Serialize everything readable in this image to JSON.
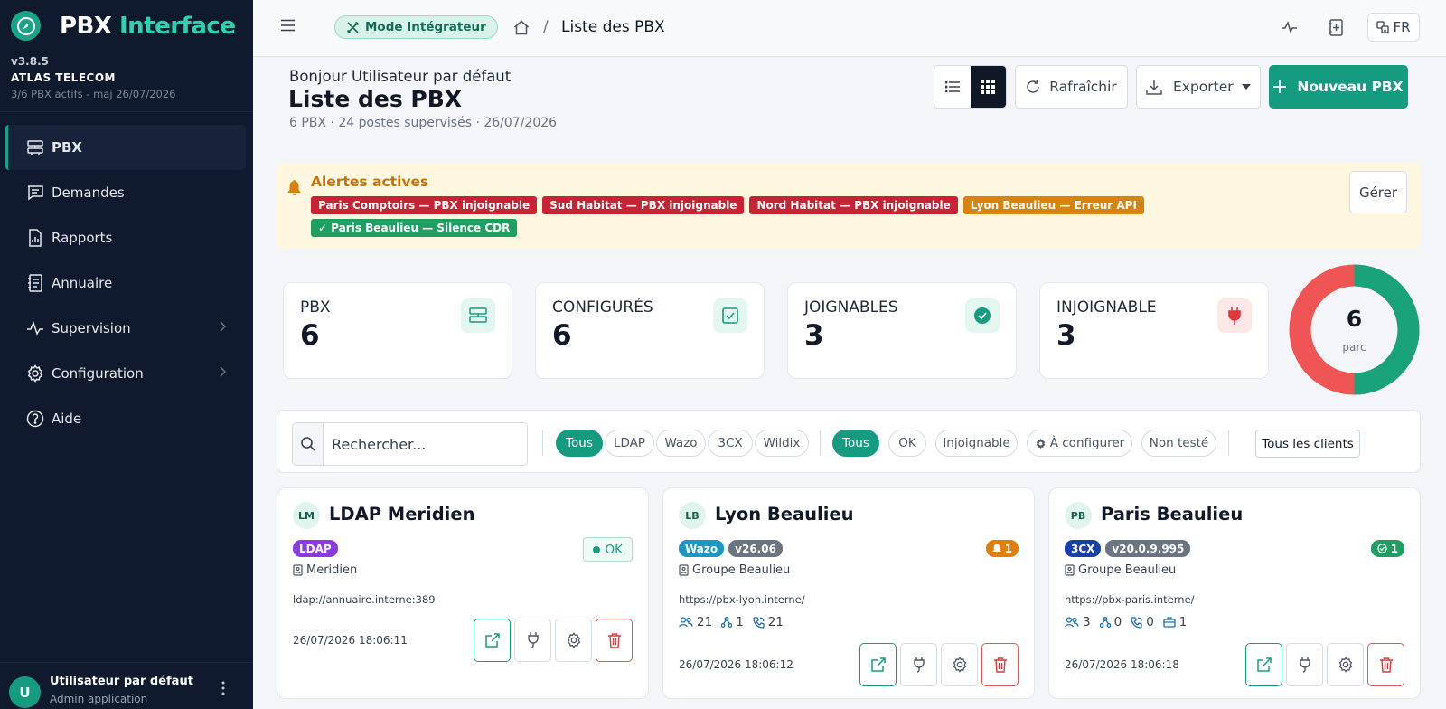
{
  "brand": {
    "name_part1": "PBX",
    "name_part2": "Interface",
    "version": "v3.8.5",
    "company": "ATLAS TELECOM",
    "status": "3/6 PBX actifs - maj 26/07/2026"
  },
  "nav": [
    {
      "label": "PBX",
      "icon": "pbx-icon",
      "active": true
    },
    {
      "label": "Demandes",
      "icon": "chat-icon"
    },
    {
      "label": "Rapports",
      "icon": "report-icon"
    },
    {
      "label": "Annuaire",
      "icon": "book-icon"
    },
    {
      "label": "Supervision",
      "icon": "pulse-icon",
      "has_children": true
    },
    {
      "label": "Configuration",
      "icon": "gear-icon",
      "has_children": true
    },
    {
      "label": "Aide",
      "icon": "help-icon"
    }
  ],
  "user": {
    "initial": "U",
    "name": "Utilisateur par défaut",
    "role": "Admin application"
  },
  "topbar": {
    "mode": "Mode Intégrateur",
    "breadcrumb_sep": "/",
    "breadcrumb_current": "Liste des PBX",
    "lang": "FR"
  },
  "header": {
    "greeting": "Bonjour Utilisateur par défaut",
    "title": "Liste des PBX",
    "subtitle": "6 PBX · 24 postes supervisés · 26/07/2026",
    "refresh": "Rafraîchir",
    "export": "Exporter",
    "new": "Nouveau PBX"
  },
  "alerts": {
    "title": "Alertes actives",
    "manage": "Gérer",
    "items": [
      {
        "text": "Paris Comptoirs — PBX injoignable",
        "level": "red"
      },
      {
        "text": "Sud Habitat — PBX injoignable",
        "level": "red"
      },
      {
        "text": "Nord Habitat — PBX injoignable",
        "level": "red"
      },
      {
        "text": "Lyon Beaulieu — Erreur API",
        "level": "orange"
      },
      {
        "text": "✓ Paris Beaulieu — Silence CDR",
        "level": "green"
      }
    ]
  },
  "stats": [
    {
      "label": "PBX",
      "value": "6",
      "icon": "pbx-icon"
    },
    {
      "label": "CONFIGURÉS",
      "value": "6",
      "icon": "checkbox-icon"
    },
    {
      "label": "JOIGNABLES",
      "value": "3",
      "icon": "check-circle-icon"
    },
    {
      "label": "INJOIGNABLE",
      "value": "3",
      "icon": "plug-icon"
    }
  ],
  "donut": {
    "total": "6",
    "label": "parc",
    "reachable": 3,
    "unreachable": 3,
    "colors": {
      "reachable": "#1aa37a",
      "unreachable": "#ef5555"
    }
  },
  "filters": {
    "search_placeholder": "Rechercher...",
    "types": [
      "Tous",
      "LDAP",
      "Wazo",
      "3CX",
      "Wildix"
    ],
    "states": [
      "Tous",
      "OK",
      "Injoignable",
      "À configurer",
      "Non testé"
    ],
    "clients": "Tous les clients"
  },
  "cards": [
    {
      "initials": "LM",
      "name": "LDAP Meridien",
      "type": "LDAP",
      "version": "",
      "status": "OK",
      "owner": "Meridien",
      "url": "ldap://annuaire.interne:389",
      "timestamp": "26/07/2026 18:06:11"
    },
    {
      "initials": "LB",
      "name": "Lyon Beaulieu",
      "type": "Wazo",
      "version": "v26.06",
      "status": "1",
      "owner": "Groupe Beaulieu",
      "url": "https://pbx-lyon.interne/",
      "metrics": [
        "21",
        "1",
        "21"
      ],
      "timestamp": "26/07/2026 18:06:12"
    },
    {
      "initials": "PB",
      "name": "Paris Beaulieu",
      "type": "3CX",
      "version": "v20.0.9.995",
      "status": "1",
      "owner": "Groupe Beaulieu",
      "url": "https://pbx-paris.interne/",
      "metrics": [
        "3",
        "0",
        "0",
        "1"
      ],
      "timestamp": "26/07/2026 18:06:18"
    }
  ],
  "colors": {
    "accent": "#159b80",
    "sidebar": "#0f1a2e",
    "danger": "#c82333",
    "warning": "#d9830f"
  }
}
